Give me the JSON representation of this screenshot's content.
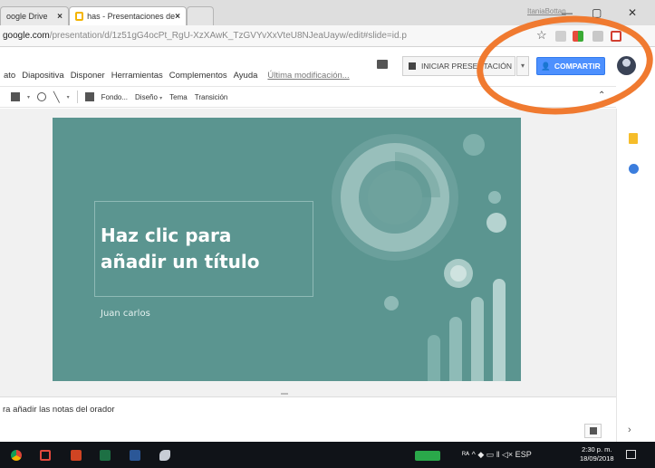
{
  "browser": {
    "tabs": [
      {
        "label": "oogle Drive"
      },
      {
        "label": "has - Presentaciones de"
      },
      {
        "label": ""
      }
    ],
    "window_user": "ItaniaBottan",
    "url": {
      "host": "google.com",
      "path": "/presentation/d/1z51gG4ocPt_RgU-XzXAwK_TzGVYvXxVteU8NJeaUayw/edit#slide=id.p"
    },
    "win_buttons": {
      "minimize": "—",
      "maximize": "▢",
      "close": "✕"
    },
    "star_icon": "☆"
  },
  "menu": {
    "items": [
      "ato",
      "Diapositiva",
      "Disponer",
      "Herramientas",
      "Complementos",
      "Ayuda"
    ],
    "last_modified": "Última modificación..."
  },
  "header": {
    "present_label": "INICIAR PRESENTACIÓN",
    "present_dropdown": "▾",
    "share_label": "COMPARTIR",
    "share_icon": "👤"
  },
  "toolbar": {
    "items": [
      {
        "label": "Fondo...",
        "caret": ""
      },
      {
        "label": "Diseño",
        "caret": "▾"
      },
      {
        "label": "Tema",
        "caret": ""
      },
      {
        "label": "Transición",
        "caret": ""
      }
    ],
    "collapse_icon": "⌃"
  },
  "slide": {
    "title_line1": "Haz clic para",
    "title_line2": "añadir un título",
    "subtitle": "Juan carlos",
    "background": "#5b9590"
  },
  "notes": {
    "placeholder": "ra añadir las notas del orador"
  },
  "side": {
    "arrow": "›"
  },
  "taskbar": {
    "tray_text": "ᴿᴬ ^ ◆ ▭ ‖ ◁× ESP",
    "time": "2:30 p. m.",
    "date": "18/09/2018"
  },
  "colors": {
    "accent_share": "#4d90fe",
    "annotation": "#f07a30"
  }
}
